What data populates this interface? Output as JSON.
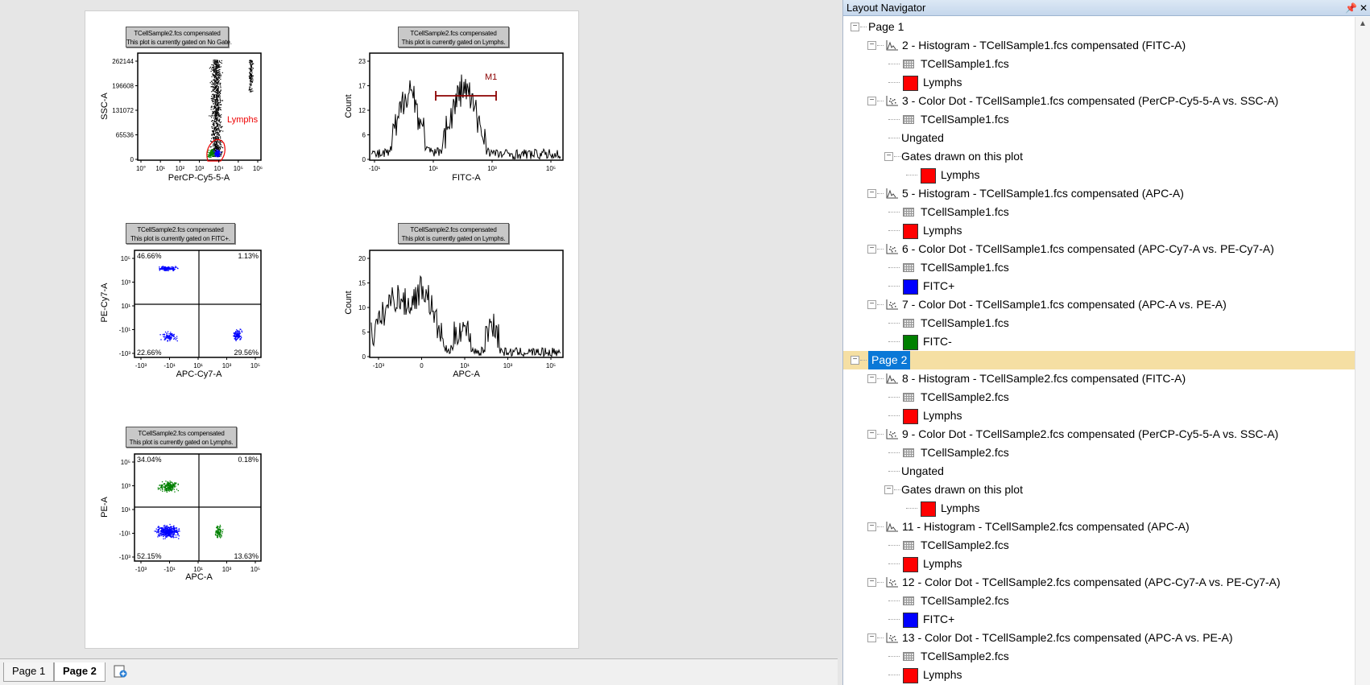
{
  "plots": [
    {
      "header": [
        "TCellSample2.fcs compensated",
        "This plot is currently gated on No Gate."
      ],
      "xlabel": "PerCP-Cy5-5-A",
      "ylabel": "SSC-A",
      "xticks": [
        "10°",
        "10¹",
        "10²",
        "10³",
        "10⁴",
        "10⁵",
        "10⁶"
      ],
      "yticks": [
        "262144",
        "196608",
        "131072",
        "65536",
        "0"
      ],
      "gate_label": "Lymphs"
    },
    {
      "header": [
        "TCellSample2.fcs compensated",
        "This plot is currently gated on Lymphs."
      ],
      "xlabel": "FITC-A",
      "ylabel": "Count",
      "xticks": [
        "-10¹",
        "10¹",
        "10³",
        "10⁵"
      ],
      "yticks": [
        "23",
        "17",
        "12",
        "6",
        "0"
      ],
      "marker_label": "M1"
    },
    {
      "header": [
        "TCellSample2.fcs compensated",
        "This plot is currently gated on FITC+."
      ],
      "xlabel": "APC-Cy7-A",
      "ylabel": "PE-Cy7-A",
      "xticks": [
        "-10³",
        "-10¹",
        "10¹",
        "10³",
        "10⁵"
      ],
      "yticks": [
        "10⁵",
        "10³",
        "10¹",
        "-10¹",
        "-10³"
      ],
      "quadrants": {
        "ul": "46.66%",
        "ur": "1.13%",
        "ll": "22.66%",
        "lr": "29.56%"
      }
    },
    {
      "header": [
        "TCellSample2.fcs compensated",
        "This plot is currently gated on Lymphs."
      ],
      "xlabel": "APC-A",
      "ylabel": "Count",
      "xticks": [
        "-10³",
        "0",
        "10¹",
        "10³",
        "10⁵"
      ],
      "yticks": [
        "20",
        "15",
        "10",
        "5",
        "0"
      ]
    },
    {
      "header": [
        "TCellSample2.fcs compensated",
        "This plot is currently gated on Lymphs."
      ],
      "xlabel": "APC-A",
      "ylabel": "PE-A",
      "xticks": [
        "-10³",
        "-10¹",
        "10¹",
        "10³",
        "10⁵"
      ],
      "yticks": [
        "10⁵",
        "10³",
        "10¹",
        "-10¹",
        "-10³"
      ],
      "quadrants": {
        "ul": "34.04%",
        "ur": "0.18%",
        "ll": "52.15%",
        "lr": "13.63%"
      }
    }
  ],
  "tabs": [
    "Page 1",
    "Page 2"
  ],
  "active_tab": "Page 2",
  "navigator": {
    "title": "Layout Navigator",
    "pin_icon": "pin-icon",
    "close_icon": "close-icon",
    "rows": [
      {
        "level": 0,
        "expander": true,
        "icon": "none",
        "label": "Page 1"
      },
      {
        "level": 1,
        "expander": true,
        "icon": "histogram",
        "label": "2 - Histogram - TCellSample1.fcs compensated (FITC-A)"
      },
      {
        "level": 2,
        "expander": false,
        "icon": "grid",
        "label": "TCellSample1.fcs"
      },
      {
        "level": 2,
        "expander": false,
        "icon": "swatch",
        "color": "#ff0000",
        "label": "Lymphs"
      },
      {
        "level": 1,
        "expander": true,
        "icon": "dot",
        "label": "3 - Color Dot - TCellSample1.fcs compensated (PerCP-Cy5-5-A vs. SSC-A)"
      },
      {
        "level": 2,
        "expander": false,
        "icon": "grid",
        "label": "TCellSample1.fcs"
      },
      {
        "level": 2,
        "expander": false,
        "icon": "none",
        "label": "Ungated"
      },
      {
        "level": 2,
        "expander": true,
        "icon": "none",
        "label": "Gates drawn on this plot"
      },
      {
        "level": 3,
        "expander": false,
        "icon": "swatch",
        "color": "#ff0000",
        "label": "Lymphs"
      },
      {
        "level": 1,
        "expander": true,
        "icon": "histogram",
        "label": "5 - Histogram - TCellSample1.fcs compensated (APC-A)"
      },
      {
        "level": 2,
        "expander": false,
        "icon": "grid",
        "label": "TCellSample1.fcs"
      },
      {
        "level": 2,
        "expander": false,
        "icon": "swatch",
        "color": "#ff0000",
        "label": "Lymphs"
      },
      {
        "level": 1,
        "expander": true,
        "icon": "dot",
        "label": "6 - Color Dot - TCellSample1.fcs compensated (APC-Cy7-A vs. PE-Cy7-A)"
      },
      {
        "level": 2,
        "expander": false,
        "icon": "grid",
        "label": "TCellSample1.fcs"
      },
      {
        "level": 2,
        "expander": false,
        "icon": "swatch",
        "color": "#0000ff",
        "label": "FITC+"
      },
      {
        "level": 1,
        "expander": true,
        "icon": "dot",
        "label": "7 - Color Dot - TCellSample1.fcs compensated (APC-A vs. PE-A)"
      },
      {
        "level": 2,
        "expander": false,
        "icon": "grid",
        "label": "TCellSample1.fcs"
      },
      {
        "level": 2,
        "expander": false,
        "icon": "swatch",
        "color": "#008000",
        "label": "FITC-"
      },
      {
        "level": 0,
        "expander": true,
        "icon": "none",
        "label": "Page 2",
        "selected": true
      },
      {
        "level": 1,
        "expander": true,
        "icon": "histogram",
        "label": "8 - Histogram - TCellSample2.fcs compensated (FITC-A)"
      },
      {
        "level": 2,
        "expander": false,
        "icon": "grid",
        "label": "TCellSample2.fcs"
      },
      {
        "level": 2,
        "expander": false,
        "icon": "swatch",
        "color": "#ff0000",
        "label": "Lymphs"
      },
      {
        "level": 1,
        "expander": true,
        "icon": "dot",
        "label": "9 - Color Dot - TCellSample2.fcs compensated (PerCP-Cy5-5-A vs. SSC-A)"
      },
      {
        "level": 2,
        "expander": false,
        "icon": "grid",
        "label": "TCellSample2.fcs"
      },
      {
        "level": 2,
        "expander": false,
        "icon": "none",
        "label": "Ungated"
      },
      {
        "level": 2,
        "expander": true,
        "icon": "none",
        "label": "Gates drawn on this plot"
      },
      {
        "level": 3,
        "expander": false,
        "icon": "swatch",
        "color": "#ff0000",
        "label": "Lymphs"
      },
      {
        "level": 1,
        "expander": true,
        "icon": "histogram",
        "label": "11 - Histogram - TCellSample2.fcs compensated (APC-A)"
      },
      {
        "level": 2,
        "expander": false,
        "icon": "grid",
        "label": "TCellSample2.fcs"
      },
      {
        "level": 2,
        "expander": false,
        "icon": "swatch",
        "color": "#ff0000",
        "label": "Lymphs"
      },
      {
        "level": 1,
        "expander": true,
        "icon": "dot",
        "label": "12 - Color Dot - TCellSample2.fcs compensated (APC-Cy7-A vs. PE-Cy7-A)"
      },
      {
        "level": 2,
        "expander": false,
        "icon": "grid",
        "label": "TCellSample2.fcs"
      },
      {
        "level": 2,
        "expander": false,
        "icon": "swatch",
        "color": "#0000ff",
        "label": "FITC+"
      },
      {
        "level": 1,
        "expander": true,
        "icon": "dot",
        "label": "13 - Color Dot - TCellSample2.fcs compensated (APC-A vs. PE-A)"
      },
      {
        "level": 2,
        "expander": false,
        "icon": "grid",
        "label": "TCellSample2.fcs"
      },
      {
        "level": 2,
        "expander": false,
        "icon": "swatch",
        "color": "#ff0000",
        "label": "Lymphs"
      }
    ]
  }
}
